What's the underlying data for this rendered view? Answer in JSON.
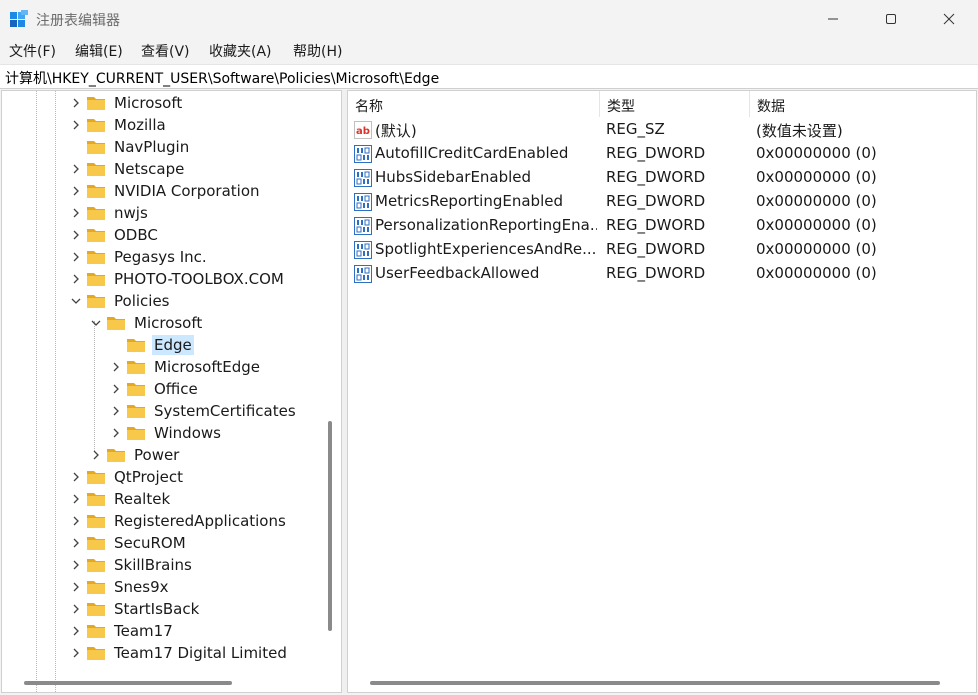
{
  "window": {
    "title": "注册表编辑器"
  },
  "menu": [
    "文件(F)",
    "编辑(E)",
    "查看(V)",
    "收藏夹(A)",
    "帮助(H)"
  ],
  "address": "计算机\\HKEY_CURRENT_USER\\Software\\Policies\\Microsoft\\Edge",
  "tree": [
    {
      "label": "Microsoft",
      "level": 0,
      "expander": "collapsed"
    },
    {
      "label": "Mozilla",
      "level": 0,
      "expander": "collapsed"
    },
    {
      "label": "NavPlugin",
      "level": 0,
      "expander": "none"
    },
    {
      "label": "Netscape",
      "level": 0,
      "expander": "collapsed"
    },
    {
      "label": "NVIDIA Corporation",
      "level": 0,
      "expander": "collapsed"
    },
    {
      "label": "nwjs",
      "level": 0,
      "expander": "collapsed"
    },
    {
      "label": "ODBC",
      "level": 0,
      "expander": "collapsed"
    },
    {
      "label": "Pegasys Inc.",
      "level": 0,
      "expander": "collapsed"
    },
    {
      "label": "PHOTO-TOOLBOX.COM",
      "level": 0,
      "expander": "collapsed"
    },
    {
      "label": "Policies",
      "level": 0,
      "expander": "expanded"
    },
    {
      "label": "Microsoft",
      "level": 1,
      "expander": "expanded"
    },
    {
      "label": "Edge",
      "level": 2,
      "expander": "none",
      "selected": true
    },
    {
      "label": "MicrosoftEdge",
      "level": 2,
      "expander": "collapsed"
    },
    {
      "label": "Office",
      "level": 2,
      "expander": "collapsed"
    },
    {
      "label": "SystemCertificates",
      "level": 2,
      "expander": "collapsed"
    },
    {
      "label": "Windows",
      "level": 2,
      "expander": "collapsed"
    },
    {
      "label": "Power",
      "level": 1,
      "expander": "collapsed"
    },
    {
      "label": "QtProject",
      "level": 0,
      "expander": "collapsed"
    },
    {
      "label": "Realtek",
      "level": 0,
      "expander": "collapsed"
    },
    {
      "label": "RegisteredApplications",
      "level": 0,
      "expander": "collapsed"
    },
    {
      "label": "SecuROM",
      "level": 0,
      "expander": "collapsed"
    },
    {
      "label": "SkillBrains",
      "level": 0,
      "expander": "collapsed"
    },
    {
      "label": "Snes9x",
      "level": 0,
      "expander": "collapsed"
    },
    {
      "label": "StartIsBack",
      "level": 0,
      "expander": "collapsed"
    },
    {
      "label": "Team17",
      "level": 0,
      "expander": "collapsed"
    },
    {
      "label": "Team17 Digital Limited",
      "level": 0,
      "expander": "collapsed"
    }
  ],
  "values": {
    "columns": [
      "名称",
      "类型",
      "数据"
    ],
    "rows": [
      {
        "name": "(默认)",
        "type": "REG_SZ",
        "data": "(数值未设置)",
        "icon": "string-value-icon"
      },
      {
        "name": "AutofillCreditCardEnabled",
        "type": "REG_DWORD",
        "data": "0x00000000 (0)",
        "icon": "binary-value-icon"
      },
      {
        "name": "HubsSidebarEnabled",
        "type": "REG_DWORD",
        "data": "0x00000000 (0)",
        "icon": "binary-value-icon"
      },
      {
        "name": "MetricsReportingEnabled",
        "type": "REG_DWORD",
        "data": "0x00000000 (0)",
        "icon": "binary-value-icon"
      },
      {
        "name": "PersonalizationReportingEna...",
        "type": "REG_DWORD",
        "data": "0x00000000 (0)",
        "icon": "binary-value-icon"
      },
      {
        "name": "SpotlightExperiencesAndRe...",
        "type": "REG_DWORD",
        "data": "0x00000000 (0)",
        "icon": "binary-value-icon"
      },
      {
        "name": "UserFeedbackAllowed",
        "type": "REG_DWORD",
        "data": "0x00000000 (0)",
        "icon": "binary-value-icon"
      }
    ]
  },
  "colors": {
    "folder": "#f8c84a",
    "folder_dark": "#e3a826",
    "selection": "#cce8ff",
    "window_bg": "#f3f3f3"
  }
}
